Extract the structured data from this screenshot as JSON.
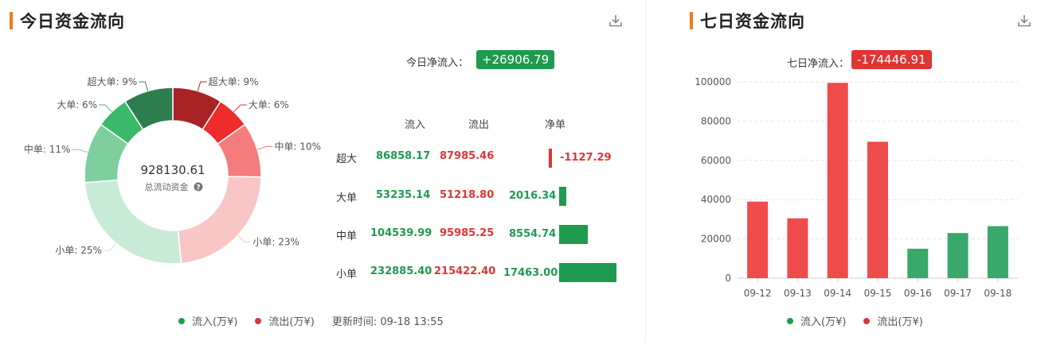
{
  "today": {
    "title": "今日资金流向",
    "net_label": "今日净流入：",
    "net_value": "+26906.79",
    "center_total": "928130.61",
    "center_label": "总流动资金",
    "table_headers": {
      "inflow": "流入",
      "outflow": "流出",
      "net": "净单"
    },
    "rows": [
      {
        "label": "超大",
        "inflow": "86858.17",
        "outflow": "87985.46",
        "net": "-1127.29",
        "net_value": -1127.29
      },
      {
        "label": "大单",
        "inflow": "53235.14",
        "outflow": "51218.80",
        "net": "2016.34",
        "net_value": 2016.34
      },
      {
        "label": "中单",
        "inflow": "104539.99",
        "outflow": "95985.25",
        "net": "8554.74",
        "net_value": 8554.74
      },
      {
        "label": "小单",
        "inflow": "232885.40",
        "outflow": "215422.40",
        "net": "17463.00",
        "net_value": 17463.0
      }
    ],
    "legend": {
      "inflow": "流入(万¥)",
      "outflow": "流出(万¥)"
    },
    "update_time": "更新时间: 09-18 13:55"
  },
  "seven_day": {
    "title": "七日资金流向",
    "net_label": "七日净流入：",
    "net_value": "-174446.91",
    "legend": {
      "inflow": "流入(万¥)",
      "outflow": "流出(万¥)"
    }
  },
  "colors": {
    "inflow": "#1e9b4f",
    "outflow": "#e03535",
    "accent": "#f07a1a"
  },
  "chart_data": [
    {
      "type": "pie",
      "donut": true,
      "center_value": "928130.61",
      "slices": [
        {
          "label": "超大单: 9%",
          "value": 9,
          "color": "#a82325",
          "side": "out"
        },
        {
          "label": "大单: 6%",
          "value": 6,
          "color": "#ee2c2c",
          "side": "out"
        },
        {
          "label": "中单: 10%",
          "value": 10,
          "color": "#f47c7c",
          "side": "out"
        },
        {
          "label": "小单: 23%",
          "value": 23,
          "color": "#f9c6c6",
          "side": "out"
        },
        {
          "label": "小单: 25%",
          "value": 25,
          "color": "#c8ebd6",
          "side": "in"
        },
        {
          "label": "中单: 11%",
          "value": 11,
          "color": "#7fcf9e",
          "side": "in"
        },
        {
          "label": "大单: 6%",
          "value": 6,
          "color": "#3cb86a",
          "side": "in"
        },
        {
          "label": "超大单: 9%",
          "value": 9,
          "color": "#2e7d4f",
          "side": "in"
        }
      ]
    },
    {
      "type": "bar",
      "categories": [
        "09-12",
        "09-13",
        "09-14",
        "09-15",
        "09-16",
        "09-17",
        "09-18"
      ],
      "values": [
        39000,
        30500,
        99500,
        69500,
        15000,
        23000,
        26500
      ],
      "colors": [
        "#ef4b4b",
        "#ef4b4b",
        "#ef4b4b",
        "#ef4b4b",
        "#3aa86a",
        "#3aa86a",
        "#3aa86a"
      ],
      "ylim": [
        0,
        100000
      ],
      "yticks": [
        0,
        20000,
        40000,
        60000,
        80000,
        100000
      ],
      "grid": true
    }
  ]
}
